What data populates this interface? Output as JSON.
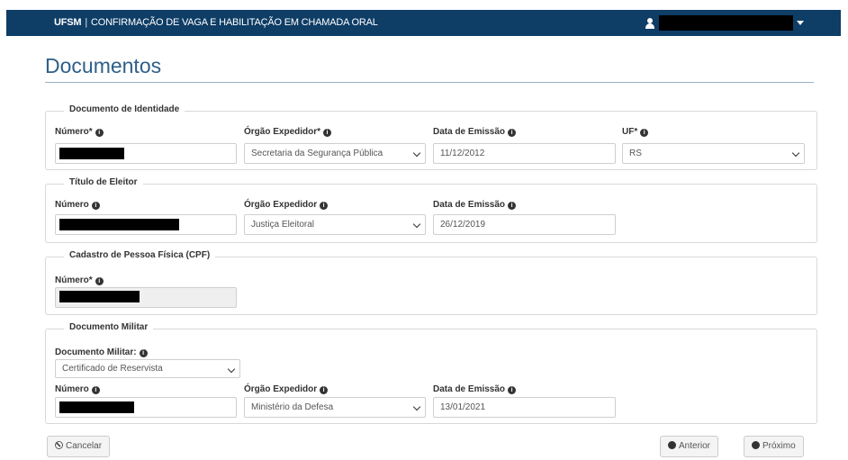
{
  "header": {
    "brand": "UFSM",
    "separator": "|",
    "app_title": "CONFIRMAÇÃO DE VAGA E HABILITAÇÃO EM CHAMADA ORAL"
  },
  "page": {
    "title": "Documentos"
  },
  "identidade": {
    "legend": "Documento de Identidade",
    "numero_label": "Número*",
    "orgao_label": "Órgão Expedidor*",
    "orgao_value": "Secretaria da Segurança Pública",
    "data_label": "Data de Emissão",
    "data_value": "11/12/2012",
    "uf_label": "UF*",
    "uf_value": "RS"
  },
  "titulo": {
    "legend": "Título de Eleitor",
    "numero_label": "Número",
    "orgao_label": "Órgão Expedidor",
    "orgao_value": "Justiça Eleitoral",
    "data_label": "Data de Emissão",
    "data_value": "26/12/2019"
  },
  "cpf": {
    "legend": "Cadastro de Pessoa Física (CPF)",
    "numero_label": "Número*"
  },
  "militar": {
    "legend": "Documento Militar",
    "tipo_label": "Documento Militar:",
    "tipo_value": "Certificado de Reservista",
    "numero_label": "Número",
    "orgao_label": "Órgão Expedidor",
    "orgao_value": "Ministério da Defesa",
    "data_label": "Data de Emissão",
    "data_value": "13/01/2021"
  },
  "footer": {
    "cancel_label": "Cancelar",
    "prev_label": "Anterior",
    "next_label": "Próximo"
  },
  "info_glyph": "i",
  "colors": {
    "topbar": "#0e3d66",
    "title": "#2e5f8a"
  }
}
